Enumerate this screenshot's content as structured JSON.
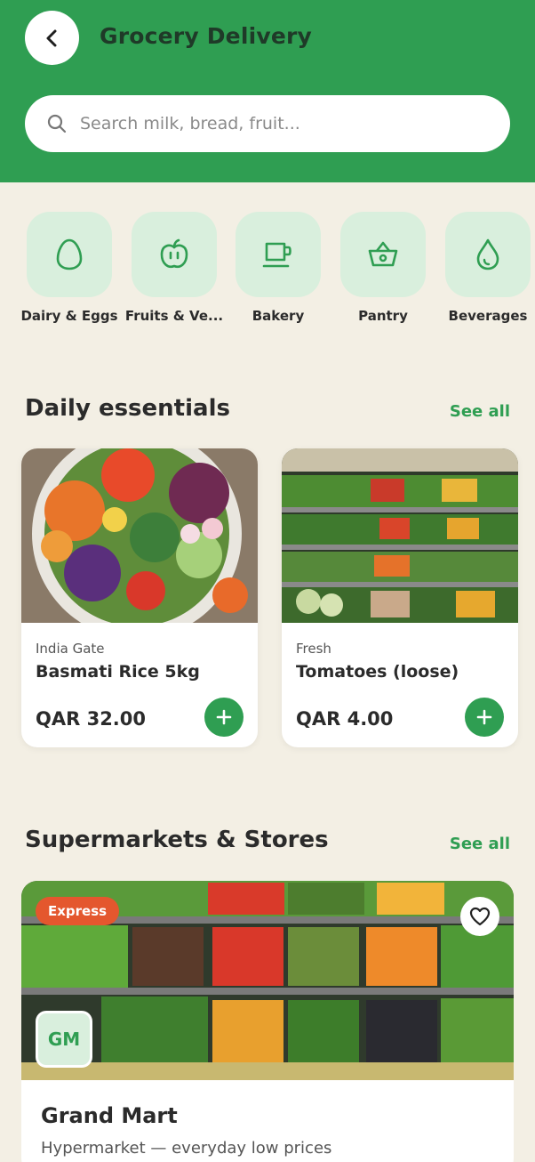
{
  "header": {
    "title": "Grocery Delivery",
    "search_placeholder": "Search milk, bread, fruit..."
  },
  "categories": [
    {
      "label": "Dairy & Eggs",
      "icon": "egg-icon"
    },
    {
      "label": "Fruits & Ve...",
      "icon": "apple-icon"
    },
    {
      "label": "Bakery",
      "icon": "cup-icon"
    },
    {
      "label": "Pantry",
      "icon": "basket-icon"
    },
    {
      "label": "Beverages",
      "icon": "drop-icon"
    }
  ],
  "daily_essentials": {
    "title": "Daily essentials",
    "see_all": "See all",
    "products": [
      {
        "brand": "India Gate",
        "name": "Basmati Rice 5kg",
        "price": "QAR 32.00"
      },
      {
        "brand": "Fresh",
        "name": "Tomatoes (loose)",
        "price": "QAR 4.00"
      }
    ]
  },
  "stores": {
    "title": "Supermarkets & Stores",
    "see_all": "See all",
    "items": [
      {
        "badge": "Express",
        "logo": "GM",
        "name": "Grand Mart",
        "description": "Hypermarket — everyday low prices"
      }
    ]
  },
  "colors": {
    "brand_green": "#2f9e52",
    "background": "#f3efe4",
    "badge_orange": "#e4572e",
    "tile_green": "#d9efdd"
  }
}
